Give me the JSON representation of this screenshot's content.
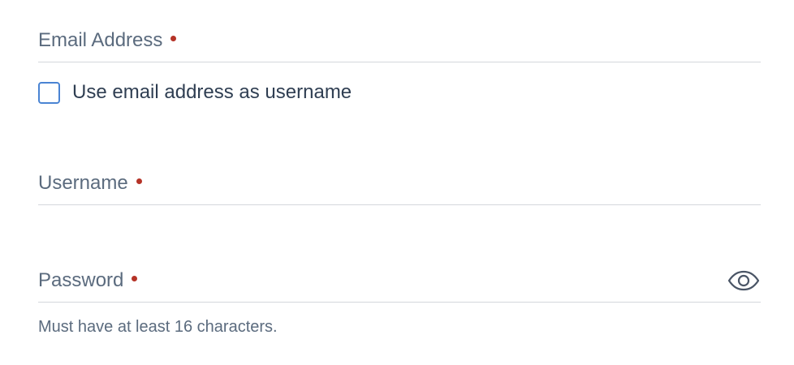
{
  "email": {
    "label": "Email Address",
    "value": "",
    "required": true
  },
  "use_email_checkbox": {
    "label": "Use email address as username",
    "checked": false
  },
  "username": {
    "label": "Username",
    "value": "",
    "required": true
  },
  "password": {
    "label": "Password",
    "value": "",
    "required": true,
    "toggle_icon": "eye-icon",
    "hint": "Must have at least 16 characters."
  },
  "colors": {
    "required_marker": "#b53327",
    "checkbox_border": "#4a84d3",
    "label_text": "#5b6b7e",
    "underline": "#d4d7dc"
  }
}
